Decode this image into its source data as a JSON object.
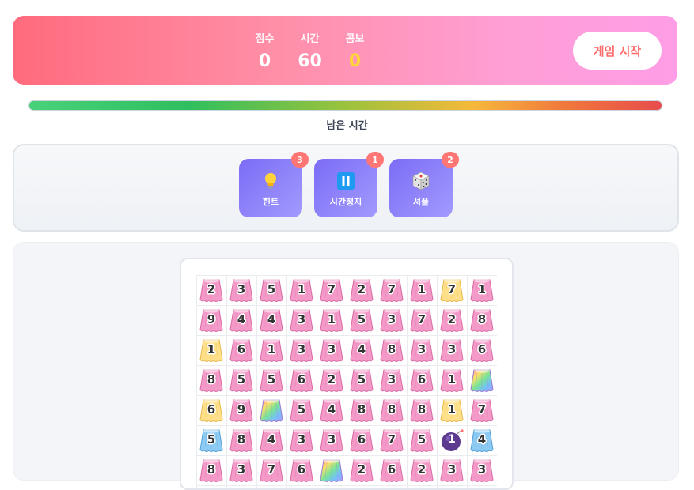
{
  "header": {
    "stats": [
      {
        "label": "점수",
        "value": "0"
      },
      {
        "label": "시간",
        "value": "60"
      },
      {
        "label": "콤보",
        "value": "0"
      }
    ],
    "start_button": "게임 시작"
  },
  "timer": {
    "label": "남은 시간",
    "remaining_fraction": 1.0
  },
  "items": [
    {
      "name": "힌트",
      "count": "3",
      "icon": "lightbulb-icon"
    },
    {
      "name": "시간정지",
      "count": "1",
      "icon": "pause-icon"
    },
    {
      "name": "셔플",
      "count": "2",
      "icon": "dice-icon"
    }
  ],
  "colors": {
    "pink": "#f49ac8",
    "yellow": "#ffe08a",
    "blue": "#8ecbf2",
    "bomb": "#5b3a8f",
    "accent": "#ff6b6b",
    "item_purple": "#7b6cf6"
  },
  "board": {
    "rows": [
      [
        {
          "n": "2",
          "t": "pink"
        },
        {
          "n": "3",
          "t": "pink"
        },
        {
          "n": "5",
          "t": "pink"
        },
        {
          "n": "1",
          "t": "pink"
        },
        {
          "n": "7",
          "t": "pink"
        },
        {
          "n": "2",
          "t": "pink"
        },
        {
          "n": "7",
          "t": "pink"
        },
        {
          "n": "1",
          "t": "pink"
        },
        {
          "n": "7",
          "t": "yellow"
        },
        {
          "n": "1",
          "t": "pink"
        }
      ],
      [
        {
          "n": "9",
          "t": "pink"
        },
        {
          "n": "4",
          "t": "pink"
        },
        {
          "n": "4",
          "t": "pink"
        },
        {
          "n": "3",
          "t": "pink"
        },
        {
          "n": "1",
          "t": "pink"
        },
        {
          "n": "5",
          "t": "pink"
        },
        {
          "n": "3",
          "t": "pink"
        },
        {
          "n": "7",
          "t": "pink"
        },
        {
          "n": "2",
          "t": "pink"
        },
        {
          "n": "8",
          "t": "pink"
        }
      ],
      [
        {
          "n": "1",
          "t": "yellow"
        },
        {
          "n": "6",
          "t": "pink"
        },
        {
          "n": "1",
          "t": "pink"
        },
        {
          "n": "3",
          "t": "pink"
        },
        {
          "n": "3",
          "t": "pink"
        },
        {
          "n": "4",
          "t": "pink"
        },
        {
          "n": "8",
          "t": "pink"
        },
        {
          "n": "3",
          "t": "pink"
        },
        {
          "n": "3",
          "t": "pink"
        },
        {
          "n": "6",
          "t": "pink"
        }
      ],
      [
        {
          "n": "8",
          "t": "pink"
        },
        {
          "n": "5",
          "t": "pink"
        },
        {
          "n": "5",
          "t": "pink"
        },
        {
          "n": "6",
          "t": "pink"
        },
        {
          "n": "2",
          "t": "pink"
        },
        {
          "n": "5",
          "t": "pink"
        },
        {
          "n": "3",
          "t": "pink"
        },
        {
          "n": "6",
          "t": "pink"
        },
        {
          "n": "1",
          "t": "pink"
        },
        {
          "n": "",
          "t": "rainbow"
        }
      ],
      [
        {
          "n": "6",
          "t": "yellow"
        },
        {
          "n": "9",
          "t": "pink"
        },
        {
          "n": "",
          "t": "rainbow"
        },
        {
          "n": "5",
          "t": "pink"
        },
        {
          "n": "4",
          "t": "pink"
        },
        {
          "n": "8",
          "t": "pink"
        },
        {
          "n": "8",
          "t": "pink"
        },
        {
          "n": "8",
          "t": "pink"
        },
        {
          "n": "1",
          "t": "yellow"
        },
        {
          "n": "7",
          "t": "pink"
        }
      ],
      [
        {
          "n": "5",
          "t": "blue"
        },
        {
          "n": "8",
          "t": "pink"
        },
        {
          "n": "4",
          "t": "pink"
        },
        {
          "n": "3",
          "t": "pink"
        },
        {
          "n": "3",
          "t": "pink"
        },
        {
          "n": "6",
          "t": "pink"
        },
        {
          "n": "7",
          "t": "pink"
        },
        {
          "n": "5",
          "t": "pink"
        },
        {
          "n": "1",
          "t": "bomb"
        },
        {
          "n": "4",
          "t": "blue"
        }
      ],
      [
        {
          "n": "8",
          "t": "pink"
        },
        {
          "n": "3",
          "t": "pink"
        },
        {
          "n": "7",
          "t": "pink"
        },
        {
          "n": "6",
          "t": "pink"
        },
        {
          "n": "",
          "t": "rainbow"
        },
        {
          "n": "2",
          "t": "pink"
        },
        {
          "n": "6",
          "t": "pink"
        },
        {
          "n": "2",
          "t": "pink"
        },
        {
          "n": "3",
          "t": "pink"
        },
        {
          "n": "3",
          "t": "pink"
        }
      ]
    ]
  }
}
